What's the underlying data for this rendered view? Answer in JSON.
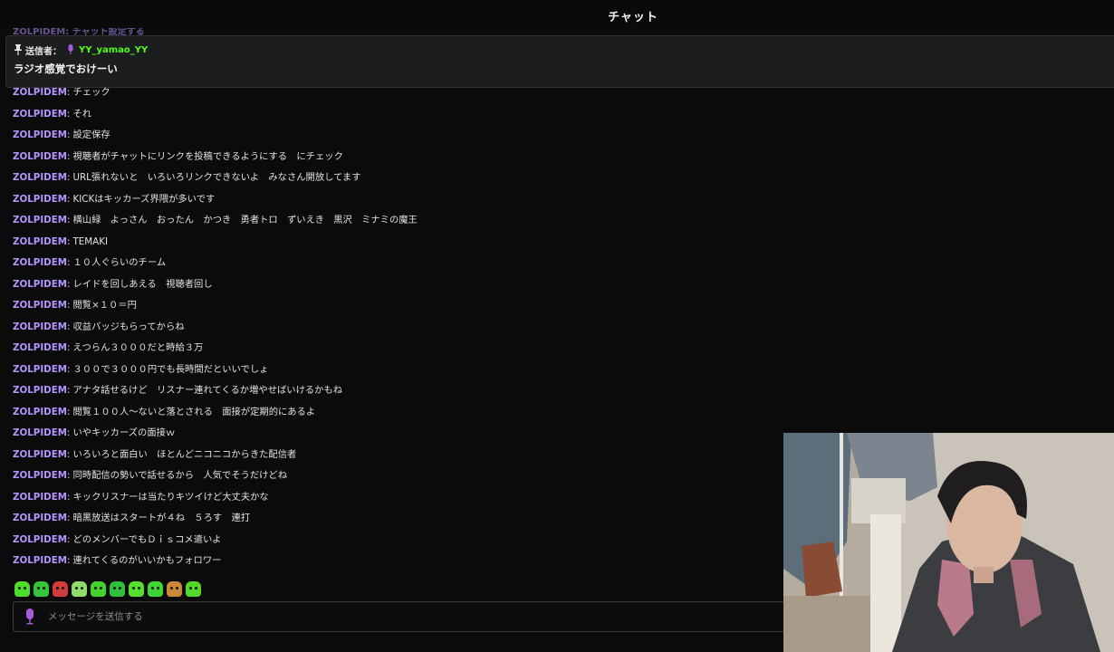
{
  "header": {
    "title": "チャット"
  },
  "pinned": {
    "sender_label": "送信者：",
    "sender": "YY_yamao_YY",
    "message": "ラジオ感覚でおけーい"
  },
  "cut_line": "ZOLPIDEM: チャット設定する",
  "messages": [
    {
      "user": "ZOLPIDEM",
      "text": "チェック"
    },
    {
      "user": "ZOLPIDEM",
      "text": "それ"
    },
    {
      "user": "ZOLPIDEM",
      "text": "設定保存"
    },
    {
      "user": "ZOLPIDEM",
      "text": "視聴者がチャットにリンクを投稿できるようにする　にチェック"
    },
    {
      "user": "ZOLPIDEM",
      "text": "URL張れないと　いろいろリンクできないよ　みなさん開放してます"
    },
    {
      "user": "ZOLPIDEM",
      "text": "KICKはキッカーズ界隈が多いです"
    },
    {
      "user": "ZOLPIDEM",
      "text": "横山緑　よっさん　おったん　かつき　勇者トロ　ずいえき　黒沢　ミナミの魔王"
    },
    {
      "user": "ZOLPIDEM",
      "text": "TEMAKI"
    },
    {
      "user": "ZOLPIDEM",
      "text": "１０人ぐらいのチーム"
    },
    {
      "user": "ZOLPIDEM",
      "text": "レイドを回しあえる　視聴者回し"
    },
    {
      "user": "ZOLPIDEM",
      "text": "閲覧×１０＝円"
    },
    {
      "user": "ZOLPIDEM",
      "text": "収益バッジもらってからね"
    },
    {
      "user": "ZOLPIDEM",
      "text": "えつらん３０００だと時給３万"
    },
    {
      "user": "ZOLPIDEM",
      "text": "３００で３０００円でも長時間だといいでしょ"
    },
    {
      "user": "ZOLPIDEM",
      "text": "アナタ話せるけど　リスナー連れてくるか増やせばいけるかもね"
    },
    {
      "user": "ZOLPIDEM",
      "text": "閲覧１００人〜ないと落とされる　面接が定期的にあるよ"
    },
    {
      "user": "ZOLPIDEM",
      "text": "いやキッカーズの面接ｗ"
    },
    {
      "user": "ZOLPIDEM",
      "text": "いろいろと面白い　ほとんどニコニコからきた配信者"
    },
    {
      "user": "ZOLPIDEM",
      "text": "同時配信の勢いで話せるから　人気でそうだけどね"
    },
    {
      "user": "ZOLPIDEM",
      "text": "キックリスナーは当たりキツイけど大丈夫かな"
    },
    {
      "user": "ZOLPIDEM",
      "text": "暗黒放送はスタートが４ね　５ろす　連打"
    },
    {
      "user": "ZOLPIDEM",
      "text": "どのメンバーでもＤｉｓコメ遣いよ"
    },
    {
      "user": "ZOLPIDEM",
      "text": "連れてくるのがいいかもフォロワー"
    }
  ],
  "emotes": [
    {
      "name": "emote-1",
      "color": "#4ddc2a"
    },
    {
      "name": "emote-2",
      "color": "#35c43a"
    },
    {
      "name": "emote-3",
      "color": "#d23b3b"
    },
    {
      "name": "emote-4",
      "color": "#8fdc6a"
    },
    {
      "name": "emote-5",
      "color": "#46d02e"
    },
    {
      "name": "emote-6",
      "color": "#2fbf3b"
    },
    {
      "name": "emote-7",
      "color": "#55e030"
    },
    {
      "name": "emote-8",
      "color": "#3ed634"
    },
    {
      "name": "emote-9",
      "color": "#c9893b"
    },
    {
      "name": "emote-10",
      "color": "#52d82a"
    }
  ],
  "input": {
    "placeholder": "メッセージを送信する"
  },
  "colors": {
    "username": "#b495ff",
    "pinned_sender": "#53fc18",
    "mic": "#a95bd6"
  }
}
